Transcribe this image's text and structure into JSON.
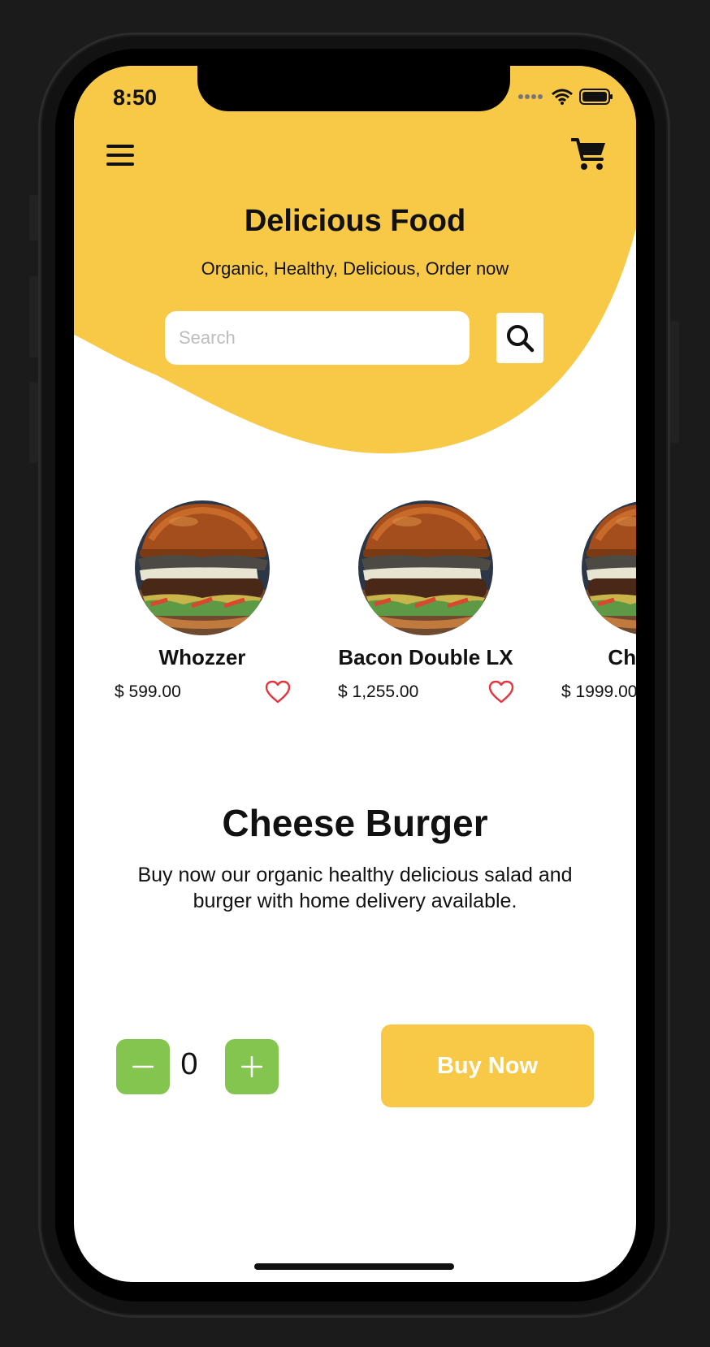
{
  "theme": {
    "accent": "#F8C947",
    "stepper": "#84C54F",
    "heart": "#E5343B"
  },
  "status_bar": {
    "time": "8:50",
    "icons": [
      "signal-icon",
      "wifi-icon",
      "battery-icon"
    ]
  },
  "header": {
    "menu_icon": "hamburger-menu-icon",
    "cart_icon": "cart-icon",
    "title": "Delicious Food",
    "subtitle": "Organic, Healthy, Delicious, Order now"
  },
  "search": {
    "placeholder": "Search",
    "value": "",
    "button_icon": "search-icon"
  },
  "products": [
    {
      "name": "Whozzer",
      "price": "$ 599.00",
      "favorite_icon": "heart-outline-icon"
    },
    {
      "name": "Bacon Double LX",
      "price": "$ 1,255.00",
      "favorite_icon": "heart-outline-icon"
    },
    {
      "name": "Chicken",
      "price": "$ 1999.00",
      "favorite_icon": "heart-outline-icon"
    }
  ],
  "detail": {
    "title": "Cheese Burger",
    "description": "Buy now our organic healthy delicious salad and burger with home delivery available.",
    "quantity": "0",
    "decrement_icon": "minus-icon",
    "increment_icon": "plus-icon",
    "buy_label": "Buy Now"
  }
}
